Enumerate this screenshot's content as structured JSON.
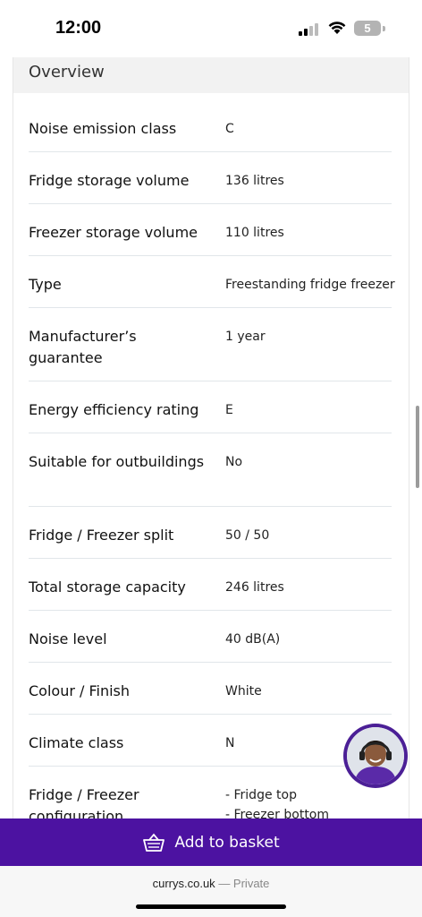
{
  "status_bar": {
    "time": "12:00",
    "battery_level": "5"
  },
  "overview": {
    "title": "Overview"
  },
  "specs": [
    {
      "label": "Noise emission class",
      "value": [
        "C"
      ]
    },
    {
      "label": "Fridge storage volume",
      "value": [
        "136 litres"
      ]
    },
    {
      "label": "Freezer storage volume",
      "value": [
        "110 litres"
      ]
    },
    {
      "label": "Type",
      "value": [
        "Freestanding fridge freezer"
      ]
    },
    {
      "label": "Manufacturer’s guarantee",
      "value": [
        "1 year"
      ]
    },
    {
      "label": "Energy efficiency rating",
      "value": [
        "E"
      ]
    },
    {
      "label": "Suitable for outbuildings",
      "value": [
        "No"
      ]
    },
    {
      "label": "Fridge / Freezer split",
      "value": [
        "50 / 50"
      ]
    },
    {
      "label": "Total storage capacity",
      "value": [
        "246 litres"
      ]
    },
    {
      "label": "Noise level",
      "value": [
        "40 dB(A)"
      ]
    },
    {
      "label": "Colour / Finish",
      "value": [
        "White"
      ]
    },
    {
      "label": "Climate class",
      "value": [
        "N"
      ]
    },
    {
      "label": "Fridge / Freezer configuration",
      "value": [
        "- Fridge top",
        "- Freezer bottom"
      ]
    }
  ],
  "basket": {
    "label": "Add to basket",
    "icon": "basket-icon"
  },
  "browser": {
    "domain": "currys.co.uk",
    "mode": "— Private"
  },
  "colors": {
    "brand_purple": "#4c12a1",
    "header_grey": "#f2f2f2",
    "divider": "#e1e6ea"
  }
}
